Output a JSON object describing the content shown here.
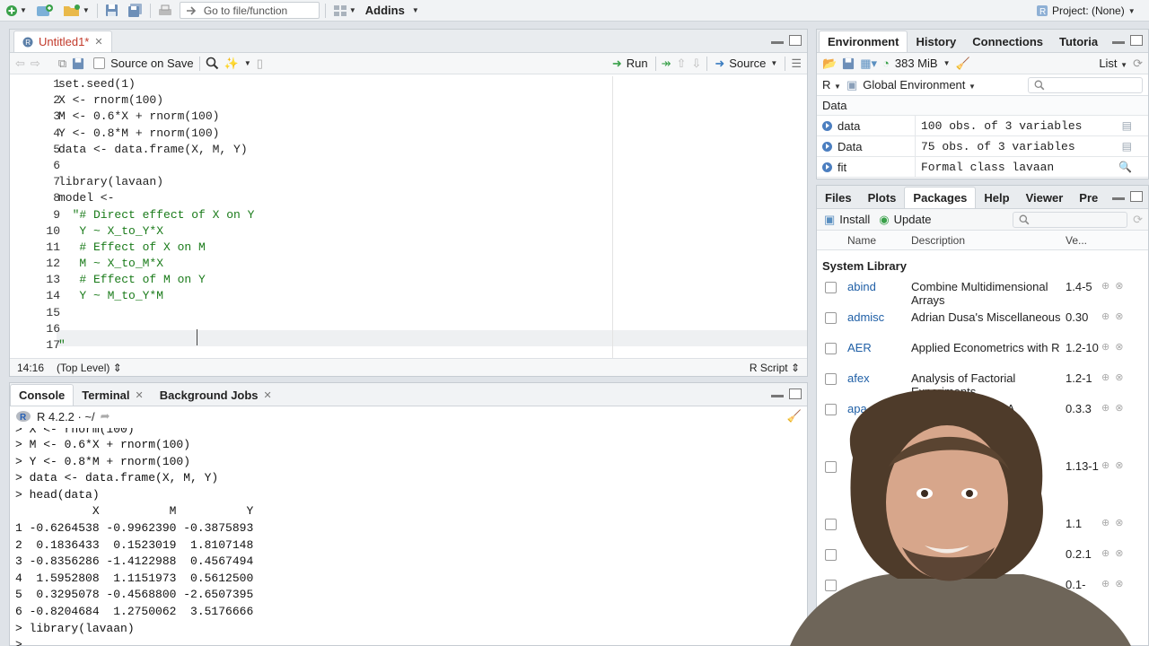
{
  "toolbar": {
    "goto_placeholder": "Go to file/function",
    "addins_label": "Addins",
    "project_label": "Project: (None)"
  },
  "editor": {
    "tab_label": "Untitled1*",
    "source_on_save": "Source on Save",
    "run_label": "Run",
    "source_label": "Source",
    "line_numbers": [
      "1",
      "2",
      "3",
      "4",
      "5",
      "6",
      "7",
      "8",
      "9",
      "10",
      "11",
      "12",
      "13",
      "14",
      "15",
      "16",
      "17"
    ],
    "lines": [
      "set.seed(1)",
      "X <- rnorm(100)",
      "M <- 0.6*X + rnorm(100)",
      "Y <- 0.8*M + rnorm(100)",
      "data <- data.frame(X, M, Y)",
      "",
      "library(lavaan)",
      "model <-",
      "  \"# Direct effect of X on Y",
      "   Y ~ X_to_Y*X",
      "   # Effect of X on M",
      "   M ~ X_to_M*X",
      "   # Effect of M on Y",
      "   Y ~ M_to_Y*M",
      "",
      "",
      "\""
    ],
    "cursor_pos": "14:16",
    "scope": "(Top Level)",
    "file_type": "R Script"
  },
  "console": {
    "tabs": [
      "Console",
      "Terminal",
      "Background Jobs"
    ],
    "r_version": "R 4.2.2 · ~/",
    "lines": [
      "> X <- rnorm(100)",
      "> M <- 0.6*X + rnorm(100)",
      "> Y <- 0.8*M + rnorm(100)",
      "> data <- data.frame(X, M, Y)",
      "> head(data)",
      "           X          M          Y",
      "1 -0.6264538 -0.9962390 -0.3875893",
      "2  0.1836433  0.1523019  1.8107148",
      "3 -0.8356286 -1.4122988  0.4567494",
      "4  1.5952808  1.1151973  0.5612500",
      "5  0.3295078 -0.4568800 -2.6507395",
      "6 -0.8204684  1.2750062  3.5176666",
      "> library(lavaan)",
      ">"
    ]
  },
  "environment": {
    "tabs": [
      "Environment",
      "History",
      "Connections",
      "Tutoria"
    ],
    "memory": "383 MiB",
    "view": "List",
    "lang": "R",
    "scope": "Global Environment",
    "section": "Data",
    "rows": [
      {
        "name": "data",
        "value": "100 obs. of 3 variables"
      },
      {
        "name": "Data",
        "value": "75 obs. of 3 variables"
      },
      {
        "name": "fit",
        "value": "Formal class  lavaan"
      }
    ]
  },
  "files": {
    "tabs": [
      "Files",
      "Plots",
      "Packages",
      "Help",
      "Viewer",
      "Pre"
    ],
    "install": "Install",
    "update": "Update",
    "col_name": "Name",
    "col_desc": "Description",
    "col_ver": "Ve...",
    "section": "System Library",
    "packages": [
      {
        "name": "abind",
        "desc": "Combine Multidimensional Arrays",
        "ver": "1.4-5"
      },
      {
        "name": "admisc",
        "desc": "Adrian Dusa's Miscellaneous",
        "ver": "0.30"
      },
      {
        "name": "AER",
        "desc": "Applied Econometrics with R",
        "ver": "1.2-10"
      },
      {
        "name": "afex",
        "desc": "Analysis of Factorial Experiments",
        "ver": "1.2-1"
      },
      {
        "name": "apa",
        "desc": "Outputs of ests APA",
        "ver": "0.3.3"
      },
      {
        "name": "",
        "desc": "ing ical",
        "ver": "1.13-1"
      },
      {
        "name": "",
        "desc": "or",
        "ver": "1.1"
      },
      {
        "name": "",
        "desc": "",
        "ver": "0.2.1"
      },
      {
        "name": "",
        "desc": "",
        "ver": "0.1-"
      }
    ]
  }
}
